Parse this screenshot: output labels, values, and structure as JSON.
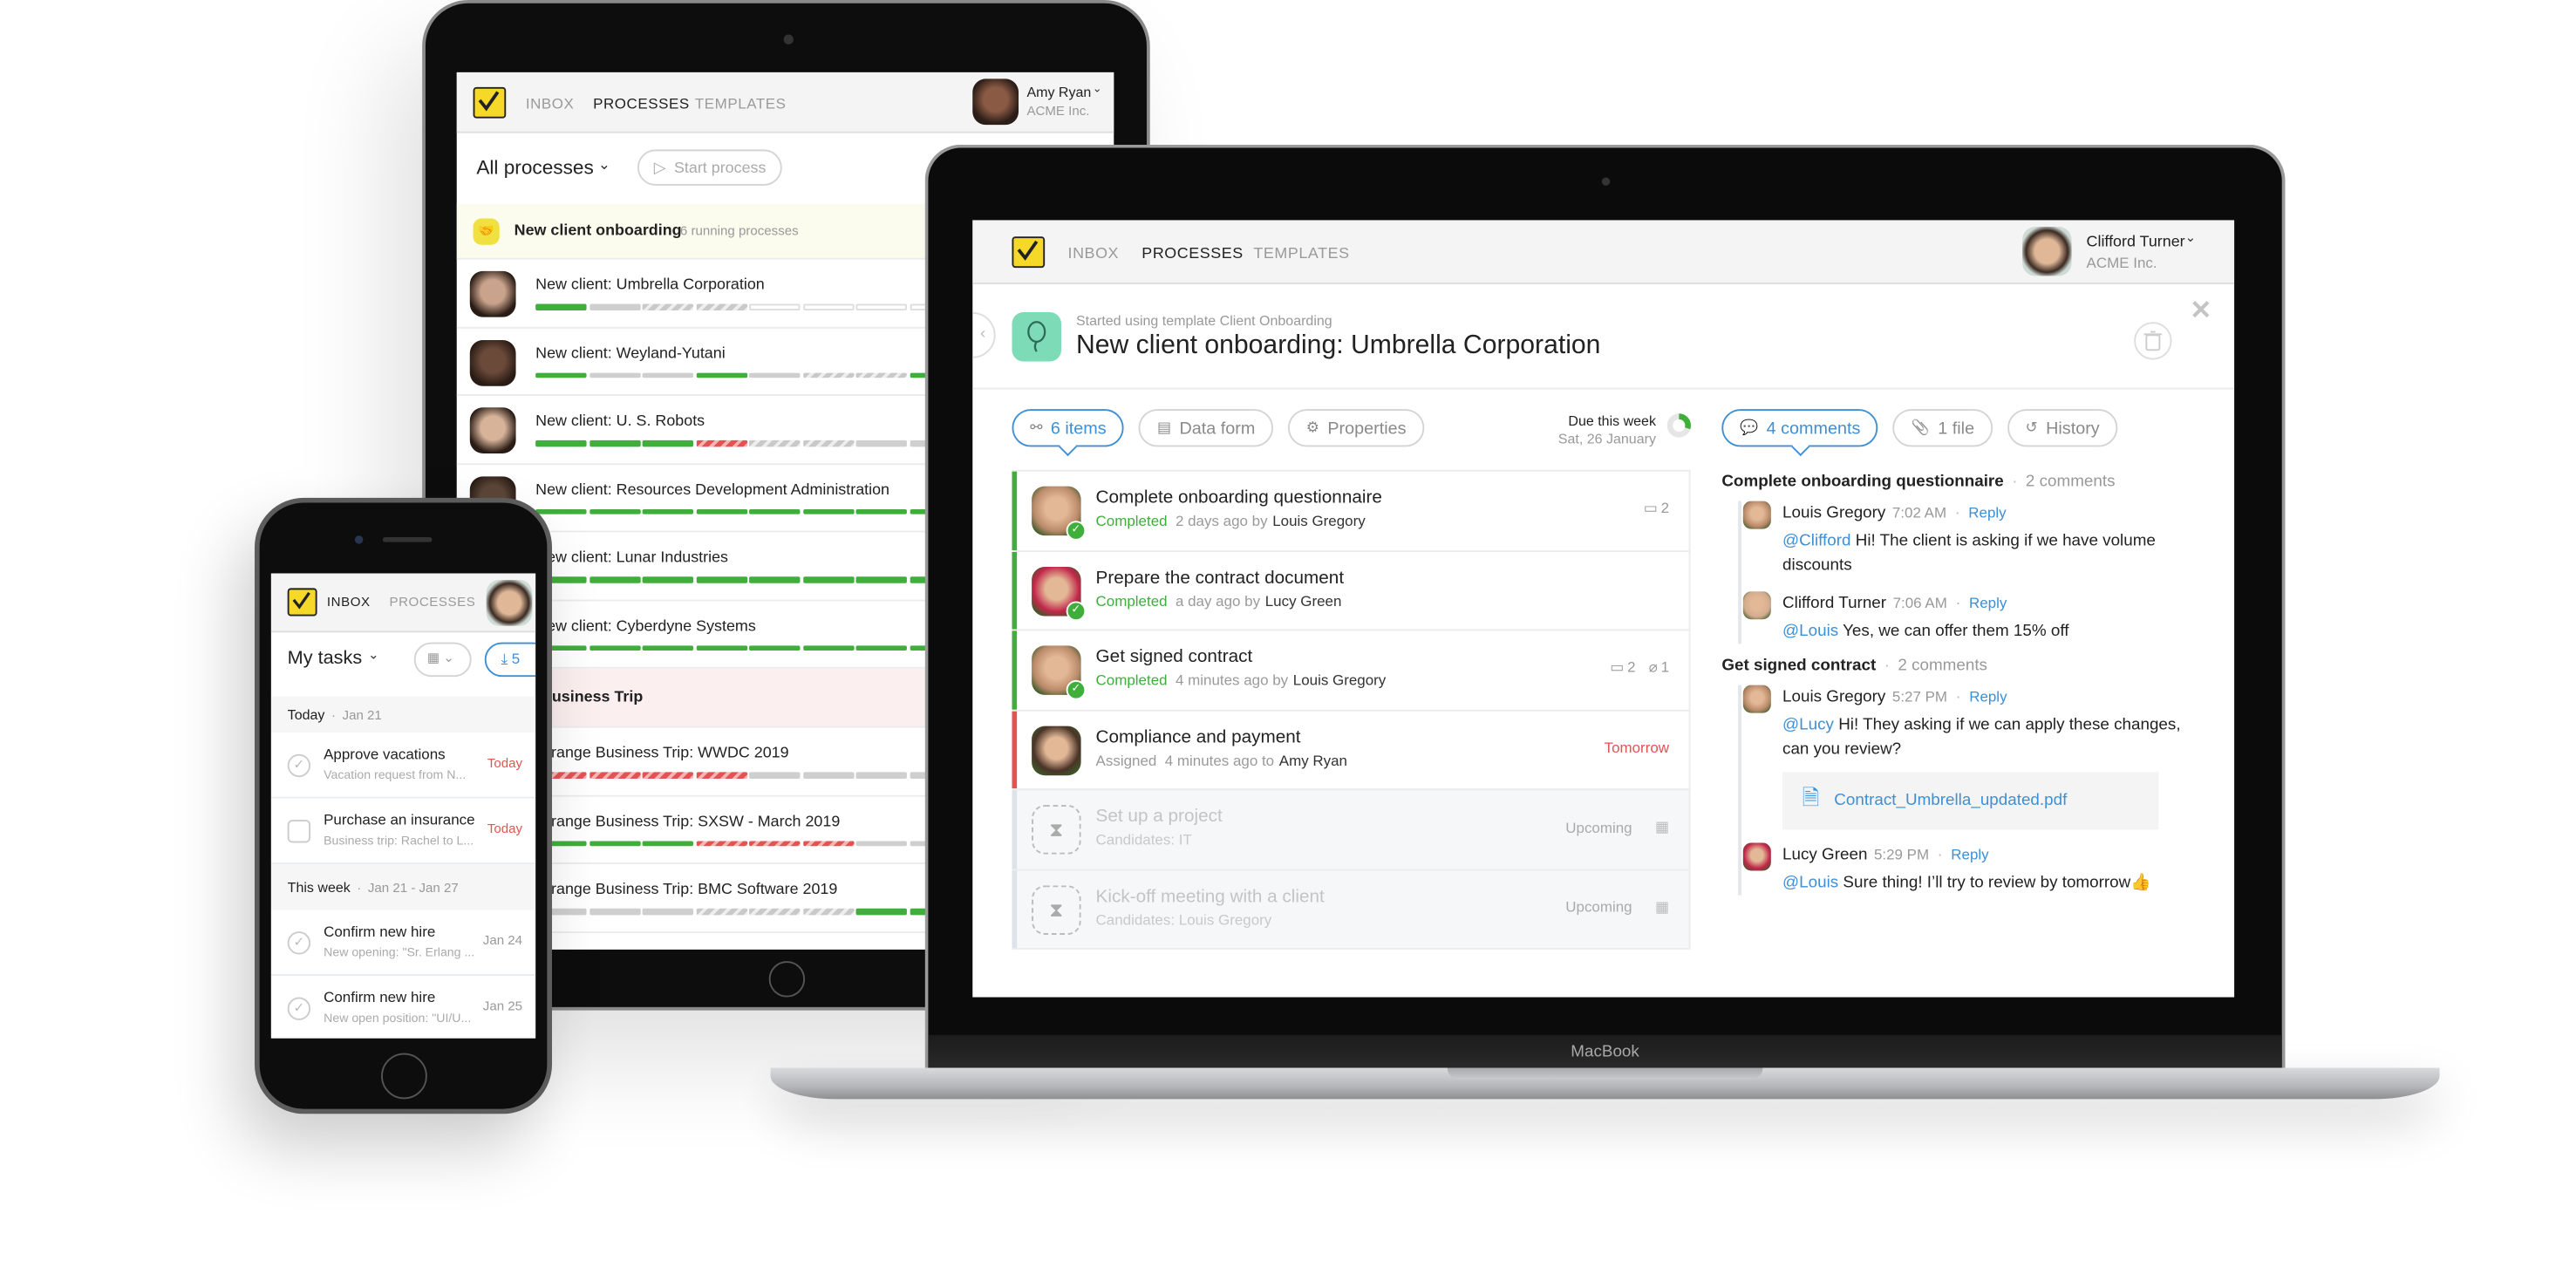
{
  "colors": {
    "accent": "#3d8fd6",
    "done": "#3fae3b",
    "overdue": "#e25454",
    "logo": "#f6d928",
    "process_icon": "#7ddbb8"
  },
  "tablet": {
    "nav": [
      "INBOX",
      "PROCESSES",
      "TEMPLATES"
    ],
    "active_nav": 1,
    "user": {
      "name": "Amy Ryan",
      "org": "ACME Inc."
    },
    "filter": "All processes",
    "start_button": "Start process",
    "groups": [
      {
        "title": "New client onboarding",
        "count": "6 running processes",
        "rows": [
          {
            "title": "New client: Umbrella Corporation",
            "avatar": "#c9a38c",
            "segments": [
              "done",
              "todo",
              "upcoming",
              "upcoming",
              "empty",
              "empty",
              "empty",
              "empty"
            ]
          },
          {
            "title": "New client: Weyland-Yutani",
            "avatar": "#6b4a3a",
            "segments": [
              "done",
              "todo",
              "todo",
              "done",
              "todo",
              "upcoming",
              "upcoming",
              "done"
            ]
          },
          {
            "title": "New client: U. S. Robots",
            "avatar": "#d7b39a",
            "segments": [
              "done",
              "done",
              "done",
              "overdue",
              "upcoming",
              "upcoming",
              "todo",
              "todo"
            ]
          },
          {
            "title": "New client: Resources Development Administration",
            "avatar": "#5b4638",
            "segments": [
              "done",
              "done",
              "done",
              "done",
              "done",
              "done",
              "done",
              "done"
            ]
          },
          {
            "title": "New client: Lunar Industries",
            "avatar": "#b08a70",
            "segments": [
              "done",
              "done",
              "done",
              "done",
              "done",
              "done",
              "done",
              "done"
            ]
          },
          {
            "title": "New client: Cyberdyne Systems",
            "avatar": "#8f6c57",
            "segments": [
              "done",
              "done",
              "done",
              "done",
              "done",
              "done",
              "done",
              "done"
            ]
          }
        ]
      },
      {
        "title": "Arrange Business Trip",
        "rows": [
          {
            "title": "Arrange Business Trip: WWDC 2019",
            "segments": [
              "overdue",
              "overdue",
              "overdue",
              "overdue",
              "todo",
              "todo",
              "todo",
              "todo"
            ]
          },
          {
            "title": "Arrange Business Trip: SXSW - March 2019",
            "segments": [
              "done",
              "done",
              "done",
              "overdue",
              "overdue",
              "overdue",
              "todo",
              "todo"
            ]
          },
          {
            "title": "Arrange Business Trip: BMC Software 2019",
            "segments": [
              "todo",
              "todo",
              "todo",
              "upcoming",
              "upcoming",
              "upcoming",
              "done",
              "done"
            ]
          }
        ]
      }
    ]
  },
  "laptop": {
    "brand": "MacBook",
    "nav": [
      "INBOX",
      "PROCESSES",
      "TEMPLATES"
    ],
    "active_nav": 1,
    "user": {
      "name": "Clifford Turner",
      "org": "ACME Inc."
    },
    "process": {
      "subtitle": "Started using template Client Onboarding",
      "title": "New client onboarding: Umbrella Corporation"
    },
    "tabs": [
      {
        "label": "6 items",
        "icon": "flow-icon",
        "active": true
      },
      {
        "label": "Data form",
        "icon": "clipboard-icon"
      },
      {
        "label": "Properties",
        "icon": "gear-icon"
      }
    ],
    "due": {
      "label": "Due this week",
      "date": "Sat, 26 January",
      "progress": 0.3
    },
    "tasks": [
      {
        "title": "Complete onboarding questionnaire",
        "status": "Completed",
        "time": "2 days ago by",
        "person": "Louis Gregory",
        "comments": "2",
        "files": "",
        "state": "done",
        "avatar": "#b98a6a"
      },
      {
        "title": "Prepare the contract document",
        "status": "Completed",
        "time": "a day ago by",
        "person": "Lucy Green",
        "comments": "",
        "files": "",
        "state": "done",
        "avatar": "#c2264a"
      },
      {
        "title": "Get signed contract",
        "status": "Completed",
        "time": "4 minutes ago by",
        "person": "Louis Gregory",
        "comments": "2",
        "files": "1",
        "state": "done",
        "avatar": "#b98a6a"
      },
      {
        "title": "Compliance and payment",
        "status": "Assigned",
        "time": "4 minutes ago to",
        "person": "Amy Ryan",
        "due": "Tomorrow",
        "state": "overdue",
        "avatar": "#4a3328"
      },
      {
        "title": "Set up a project",
        "status": "Candidates: IT",
        "due": "Upcoming",
        "state": "upcoming"
      },
      {
        "title": "Kick-off meeting with a client",
        "status": "Candidates: Louis Gregory",
        "due": "Upcoming",
        "state": "upcoming"
      }
    ],
    "comment_tabs": [
      {
        "label": "4 comments",
        "icon": "comment-icon",
        "active": true
      },
      {
        "label": "1 file",
        "icon": "paperclip-icon"
      },
      {
        "label": "History",
        "icon": "history-icon"
      }
    ],
    "threads": [
      {
        "task": "Complete onboarding questionnaire",
        "count": "2 comments",
        "comments": [
          {
            "author": "Louis Gregory",
            "time": "7:02 AM",
            "reply": "Reply",
            "mention": "@Clifford",
            "text": " Hi! The client is asking if we have volume discounts",
            "avatar": "#b98a6a"
          },
          {
            "author": "Clifford Turner",
            "time": "7:06 AM",
            "reply": "Reply",
            "mention": "@Louis",
            "text": " Yes, we can offer them 15% off",
            "avatar": "#d2ab8f"
          }
        ]
      },
      {
        "task": "Get signed contract",
        "count": "2 comments",
        "comments": [
          {
            "author": "Louis Gregory",
            "time": "5:27 PM",
            "reply": "Reply",
            "mention": "@Lucy",
            "text": " Hi! They asking if we can apply these changes, can you review?",
            "attachment": "Contract_Umbrella_updated.pdf",
            "avatar": "#b98a6a"
          },
          {
            "author": "Lucy Green",
            "time": "5:29 PM",
            "reply": "Reply",
            "mention": "@Louis",
            "text": "  Sure thing! I’ll try to review by tomorrow👍",
            "avatar": "#c2264a"
          }
        ]
      }
    ]
  },
  "phone": {
    "nav": [
      "INBOX",
      "PROCESSES"
    ],
    "active_nav": 0,
    "title": "My tasks",
    "download_count": "5",
    "sections": [
      {
        "label": "Today",
        "date": "Jan 21",
        "tasks": [
          {
            "title": "Approve vacations",
            "subtitle": "Vacation request from N...",
            "due": "Today",
            "overdue": true,
            "check": "circle"
          },
          {
            "title": "Purchase an insurance",
            "subtitle": "Business trip: Rachel to L...",
            "due": "Today",
            "overdue": true,
            "check": "box"
          }
        ]
      },
      {
        "label": "This week",
        "date": "Jan 21 - Jan 27",
        "tasks": [
          {
            "title": "Confirm new hire",
            "subtitle": "New opening: \"Sr. Erlang ...",
            "due": "Jan 24",
            "check": "circle"
          },
          {
            "title": "Confirm new hire",
            "subtitle": "New open position: \"UI/U...",
            "due": "Jan 25",
            "check": "circle"
          }
        ]
      }
    ]
  }
}
